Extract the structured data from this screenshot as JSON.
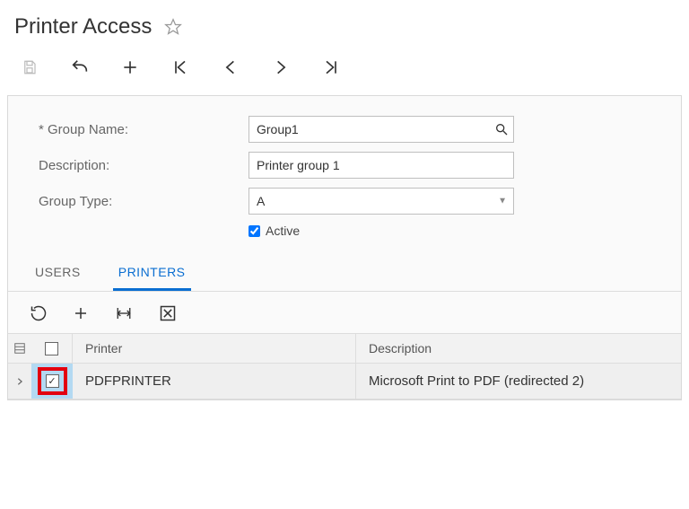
{
  "header": {
    "title": "Printer Access"
  },
  "form": {
    "group_name_label": "Group Name:",
    "group_name_value": "Group1",
    "description_label": "Description:",
    "description_value": "Printer group 1",
    "group_type_label": "Group Type:",
    "group_type_value": "A",
    "active_label": "Active",
    "active_checked": true
  },
  "tabs": {
    "users": "USERS",
    "printers": "PRINTERS",
    "active": "printers"
  },
  "grid": {
    "columns": {
      "printer": "Printer",
      "description": "Description"
    },
    "rows": [
      {
        "selected": true,
        "printer": "PDFPRINTER",
        "description": "Microsoft Print to PDF (redirected 2)"
      }
    ]
  }
}
